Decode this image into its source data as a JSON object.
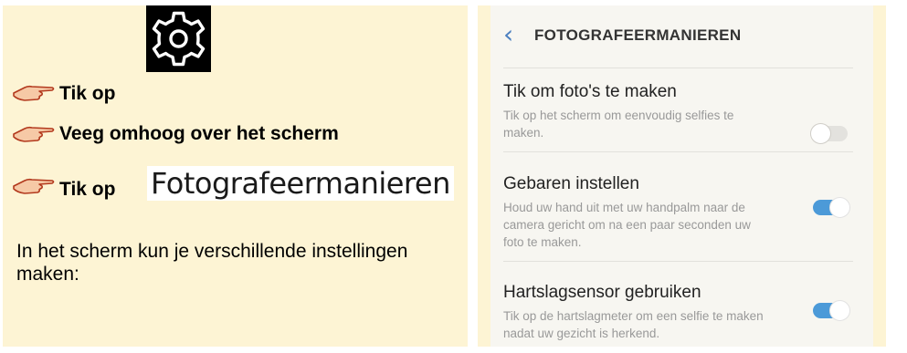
{
  "instructions": {
    "step1_text": "Tik op",
    "step2_text": "Veeg omhoog over het scherm",
    "step3_text": "Tik op",
    "step3_menu_label": "Fotografeermanieren",
    "description": "In het scherm kun je verschillende instellingen maken:",
    "icons": {
      "pointer": "pointing-hand-icon",
      "settings": "gear-icon"
    }
  },
  "phone": {
    "header": {
      "back_icon": "chevron-left-icon",
      "title": "FOTOGRAFEERMANIEREN"
    },
    "settings": [
      {
        "title": "Tik om foto's te maken",
        "description": "Tik op het scherm om eenvoudig selfies te maken.",
        "enabled": false
      },
      {
        "title": "Gebaren instellen",
        "description": "Houd uw hand uit met uw handpalm naar de camera gericht om na een paar seconden uw foto te maken.",
        "enabled": true
      },
      {
        "title": "Hartslagsensor gebruiken",
        "description": "Tik op de hartslagmeter om een selfie te maken nadat uw gezicht is herkend.",
        "enabled": true
      }
    ],
    "colors": {
      "accent": "#4c9ad8",
      "header_back": "#4a7fc0",
      "panel_background": "#fdf4d4"
    }
  }
}
